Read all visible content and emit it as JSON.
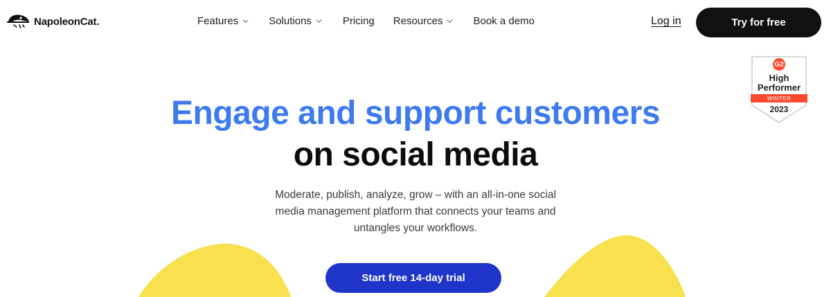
{
  "brand": {
    "name": "NapoleonCat",
    "name_suffix": "."
  },
  "nav": {
    "items": [
      {
        "label": "Features",
        "has_dropdown": true
      },
      {
        "label": "Solutions",
        "has_dropdown": true
      },
      {
        "label": "Pricing",
        "has_dropdown": false
      },
      {
        "label": "Resources",
        "has_dropdown": true
      },
      {
        "label": "Book a demo",
        "has_dropdown": false
      }
    ],
    "login_label": "Log in",
    "try_label": "Try for free"
  },
  "badge": {
    "logo": "G2",
    "line1": "High",
    "line2": "Performer",
    "season": "WINTER",
    "year": "2023"
  },
  "hero": {
    "title_line1": "Engage and support customers",
    "title_line2": "on social media",
    "subtitle_line1": "Moderate, publish, analyze, grow – with an all-in-one social",
    "subtitle_line2": "media management platform that connects your teams and",
    "subtitle_line3": "untangles your workflows.",
    "cta_label": "Start free 14-day trial"
  },
  "colors": {
    "accent_blue": "#3d7af0",
    "cta_blue": "#1f35c9",
    "blob_yellow": "#f8e04e",
    "badge_red": "#ff492c",
    "dark": "#111111"
  }
}
